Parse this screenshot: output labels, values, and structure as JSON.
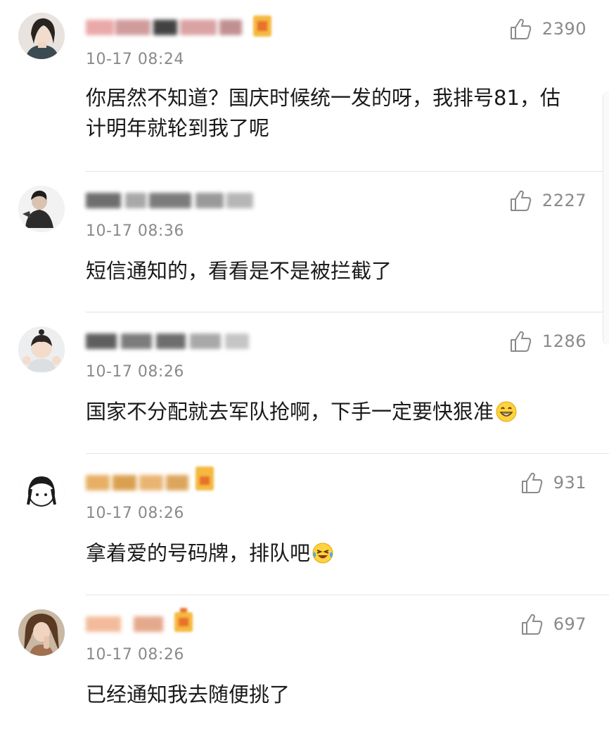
{
  "comments": [
    {
      "time": "10-17 08:24",
      "text": "你居然不知道？国庆时候统一发的呀，我排号81，估计明年就轮到我了呢",
      "likes": "2390",
      "has_vip_badge": true
    },
    {
      "time": "10-17 08:36",
      "text": "短信通知的，看看是不是被拦截了",
      "likes": "2227",
      "has_vip_badge": false
    },
    {
      "time": "10-17 08:26",
      "text": "国家不分配就去军队抢啊，下手一定要快狠准",
      "likes": "1286",
      "has_vip_badge": false,
      "emoji": "grinning-face-emoji"
    },
    {
      "time": "10-17 08:26",
      "text": "拿着爱的号码牌，排队吧",
      "likes": "931",
      "has_vip_badge": true,
      "emoji": "laughing-tears-emoji"
    },
    {
      "time": "10-17 08:26",
      "text": "已经通知我去随便挑了",
      "likes": "697",
      "has_vip_badge": true
    }
  ],
  "colors": {
    "timestamp": "#8a8a8a",
    "like_count": "#8a8a8a",
    "divider": "#e4e4e4",
    "vip_badge": "#f5a623"
  },
  "icons": {
    "like": "thumbs-up-outline-icon"
  }
}
